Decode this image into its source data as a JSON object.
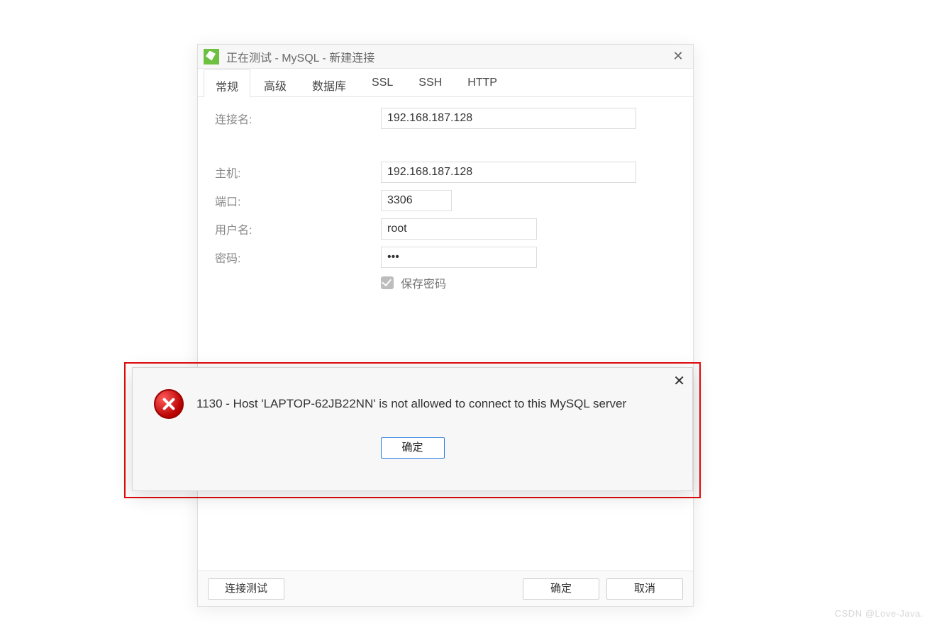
{
  "window": {
    "title": "正在测试 - MySQL - 新建连接"
  },
  "tabs": [
    {
      "label": "常规",
      "active": true
    },
    {
      "label": "高级",
      "active": false
    },
    {
      "label": "数据库",
      "active": false
    },
    {
      "label": "SSL",
      "active": false
    },
    {
      "label": "SSH",
      "active": false
    },
    {
      "label": "HTTP",
      "active": false
    }
  ],
  "form": {
    "connection_name_label": "连接名:",
    "connection_name_value": "192.168.187.128",
    "host_label": "主机:",
    "host_value": "192.168.187.128",
    "port_label": "端口:",
    "port_value": "3306",
    "user_label": "用户名:",
    "user_value": "root",
    "password_label": "密码:",
    "password_value": "***",
    "save_password_label": "保存密码",
    "save_password_checked": true
  },
  "footer": {
    "test_button": "连接测试",
    "ok_button": "确定",
    "cancel_button": "取消"
  },
  "dialog": {
    "message": "1130 - Host 'LAPTOP-62JB22NN' is not allowed to connect to this MySQL server",
    "ok_button": "确定"
  },
  "watermark": "CSDN @Love-Java."
}
